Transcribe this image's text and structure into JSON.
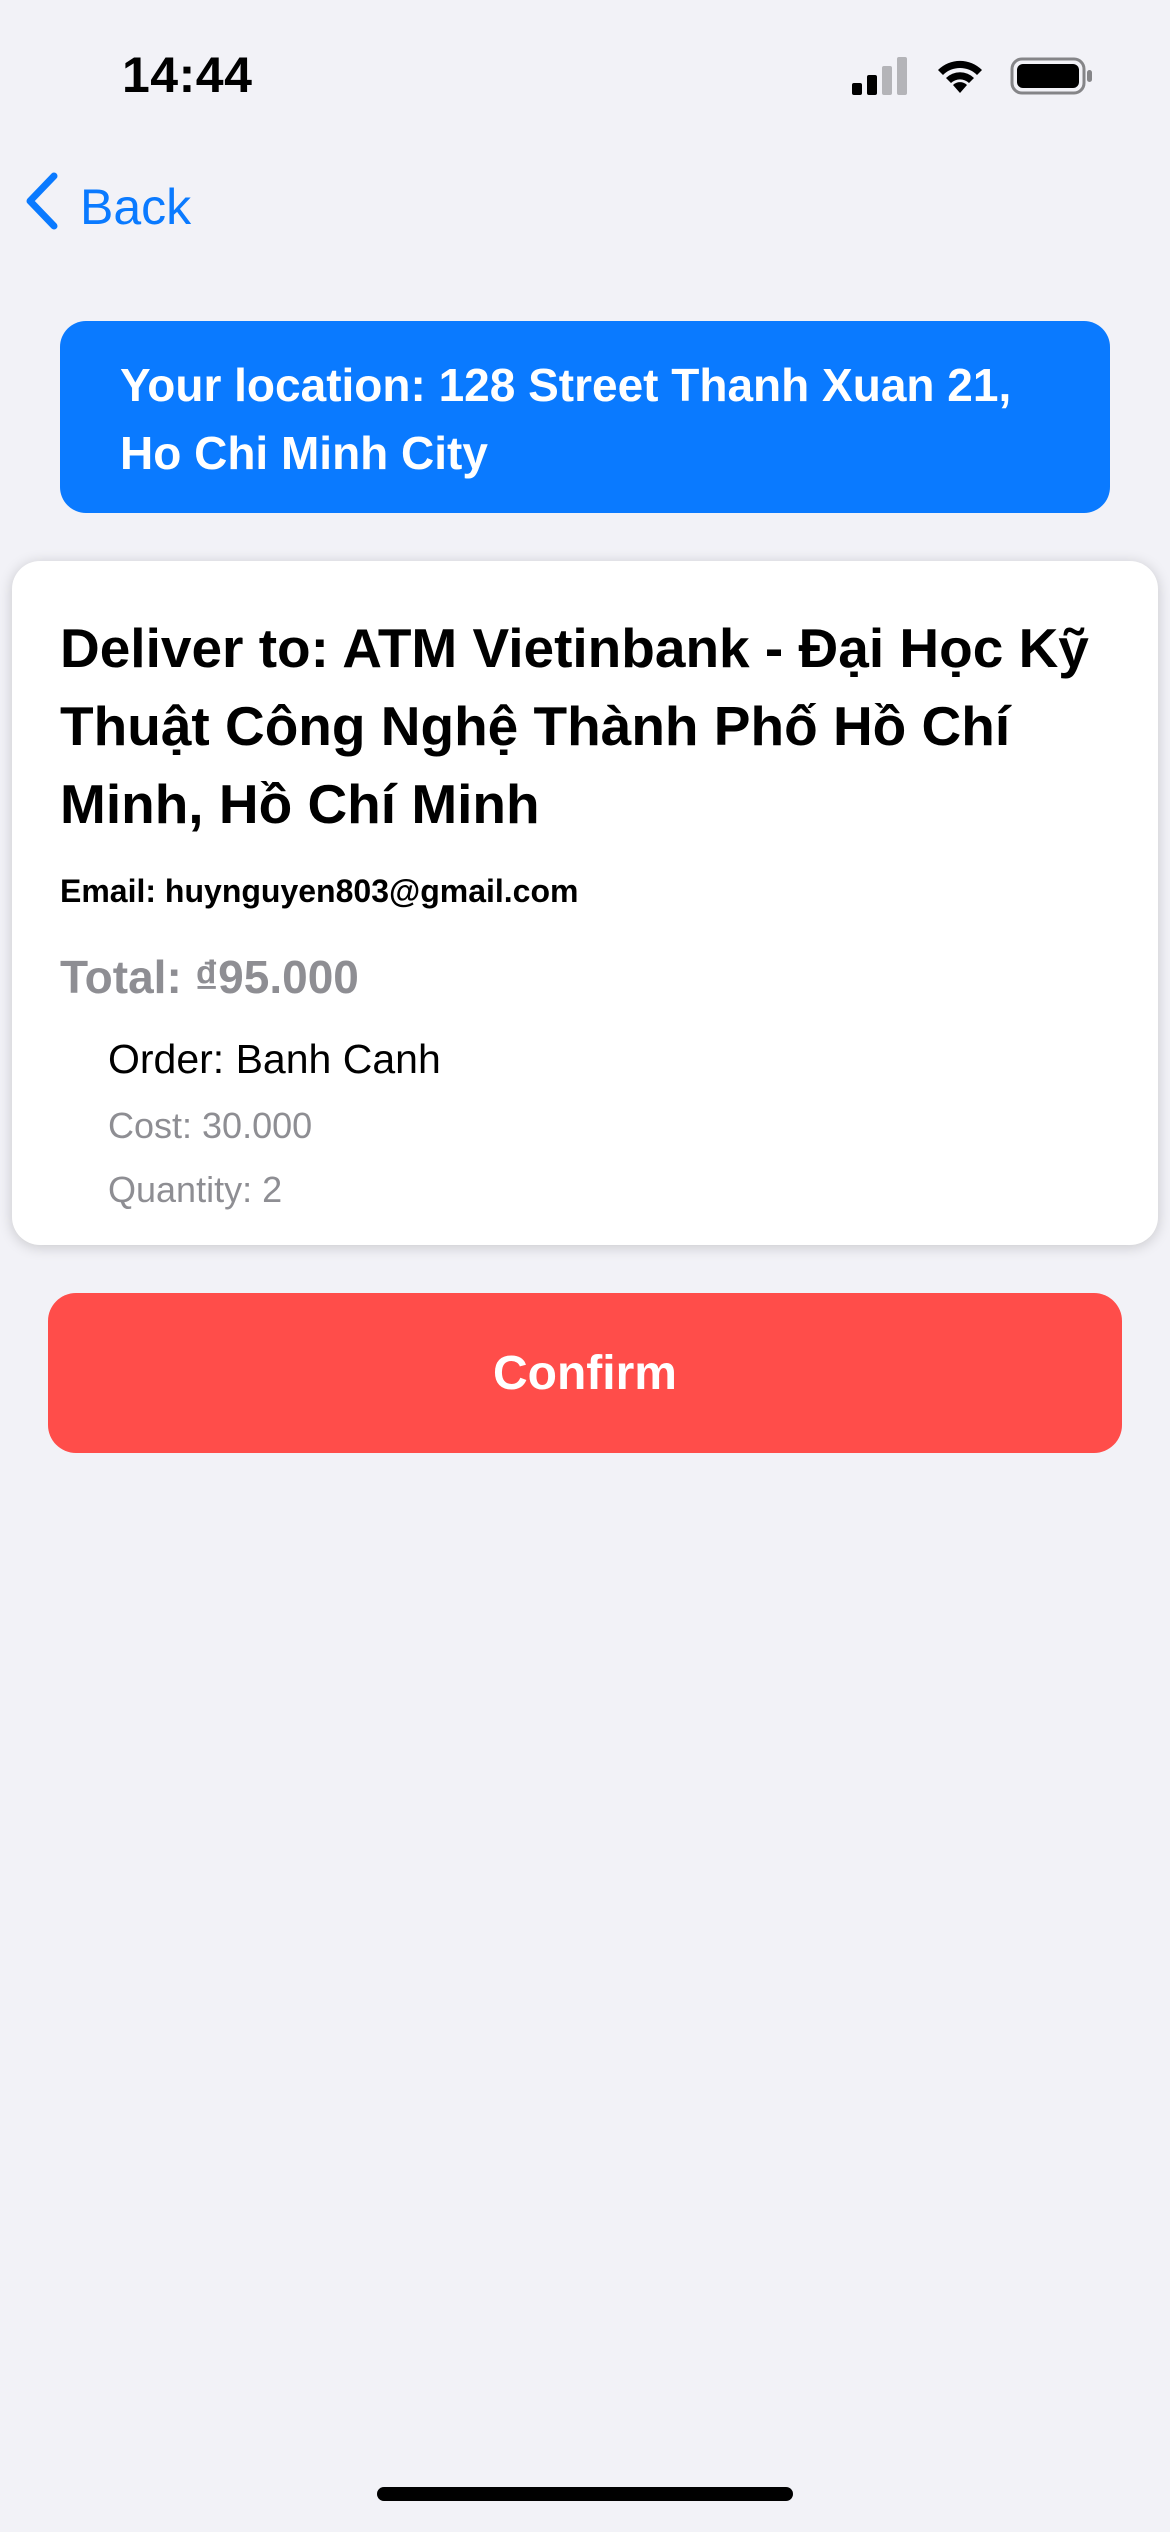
{
  "status_bar": {
    "time": "14:44",
    "icons": [
      "cellular-signal-icon",
      "wifi-icon",
      "battery-icon"
    ]
  },
  "nav": {
    "back_label": "Back"
  },
  "location_banner": {
    "text": "Your location: 128 Street Thanh Xuan 21, Ho Chi Minh City"
  },
  "order": {
    "deliver_to": "Deliver to: ATM Vietinbank - Đại Học Kỹ Thuật Công Nghệ Thành Phố Hồ Chí Minh, Hồ Chí Minh",
    "email": "Email: huynguyen803@gmail.com",
    "total": "Total: ₫95.000",
    "items": [
      {
        "name": "Order: Banh Canh",
        "cost": "Cost: 30.000",
        "quantity": "Quantity: 2"
      }
    ]
  },
  "actions": {
    "confirm_label": "Confirm"
  },
  "colors": {
    "accent": "#0a7aff",
    "confirm": "#ff4d4a",
    "background": "#f2f2f7",
    "secondary_text": "#8e8e93"
  }
}
